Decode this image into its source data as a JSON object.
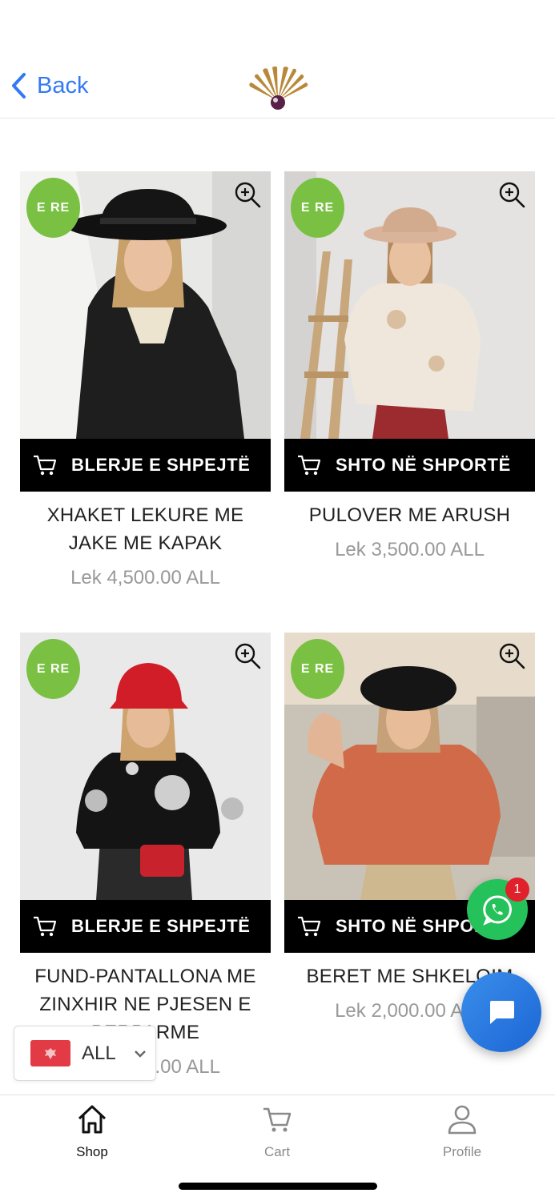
{
  "header": {
    "back_label": "Back"
  },
  "products": [
    {
      "badge": "E RE",
      "cta_label": "BLERJE E SHPEJTË",
      "title": "XHAKET LEKURE ME JAKE ME KAPAK",
      "price": "Lek 4,500.00 ALL"
    },
    {
      "badge": "E RE",
      "cta_label": "SHTO NË SHPORTË",
      "title": "PULOVER ME ARUSH",
      "price": "Lek 3,500.00 ALL"
    },
    {
      "badge": "E RE",
      "cta_label": "BLERJE E SHPEJTË",
      "title": "FUND-PANTALLONA ME ZINXHIR NE PJESEN E PERPARME",
      "price": "Lek 3,000.00 ALL"
    },
    {
      "badge": "E RE",
      "cta_label": "SHTO NË SHPORTË",
      "title": "BERET ME SHKELQIM",
      "price": "Lek 2,000.00 ALL"
    }
  ],
  "whatsapp": {
    "badge_count": "1"
  },
  "currency": {
    "selected": "ALL"
  },
  "tabbar": {
    "shop": "Shop",
    "cart": "Cart",
    "profile": "Profile"
  },
  "colors": {
    "accent": "#3478f6",
    "badge_green": "#7ac143",
    "whatsapp": "#25c15a",
    "chat": "#2a7be4"
  },
  "icons": [
    "chevron-left-icon",
    "brand-logo",
    "zoom-in-icon",
    "cart-icon",
    "whatsapp-icon",
    "chat-icon",
    "home-icon",
    "user-icon",
    "chevron-down-icon"
  ]
}
